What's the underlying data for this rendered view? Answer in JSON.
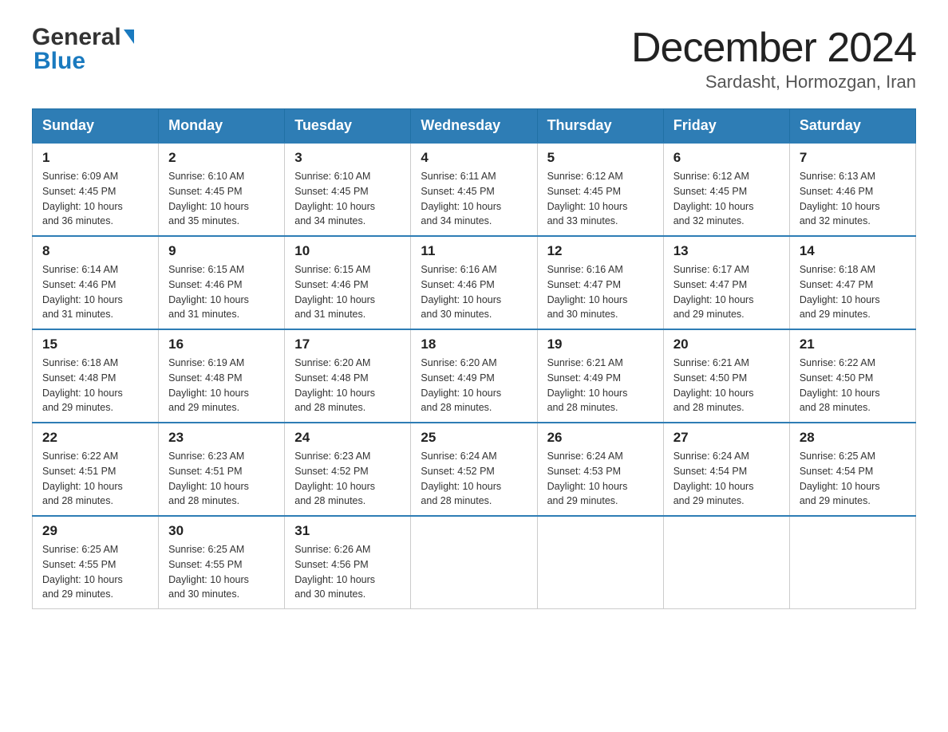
{
  "header": {
    "logo_general": "General",
    "logo_blue": "Blue",
    "month_title": "December 2024",
    "subtitle": "Sardasht, Hormozgan, Iran"
  },
  "days_of_week": [
    "Sunday",
    "Monday",
    "Tuesday",
    "Wednesday",
    "Thursday",
    "Friday",
    "Saturday"
  ],
  "weeks": [
    [
      {
        "day": "1",
        "sunrise": "6:09 AM",
        "sunset": "4:45 PM",
        "daylight": "10 hours and 36 minutes."
      },
      {
        "day": "2",
        "sunrise": "6:10 AM",
        "sunset": "4:45 PM",
        "daylight": "10 hours and 35 minutes."
      },
      {
        "day": "3",
        "sunrise": "6:10 AM",
        "sunset": "4:45 PM",
        "daylight": "10 hours and 34 minutes."
      },
      {
        "day": "4",
        "sunrise": "6:11 AM",
        "sunset": "4:45 PM",
        "daylight": "10 hours and 34 minutes."
      },
      {
        "day": "5",
        "sunrise": "6:12 AM",
        "sunset": "4:45 PM",
        "daylight": "10 hours and 33 minutes."
      },
      {
        "day": "6",
        "sunrise": "6:12 AM",
        "sunset": "4:45 PM",
        "daylight": "10 hours and 32 minutes."
      },
      {
        "day": "7",
        "sunrise": "6:13 AM",
        "sunset": "4:46 PM",
        "daylight": "10 hours and 32 minutes."
      }
    ],
    [
      {
        "day": "8",
        "sunrise": "6:14 AM",
        "sunset": "4:46 PM",
        "daylight": "10 hours and 31 minutes."
      },
      {
        "day": "9",
        "sunrise": "6:15 AM",
        "sunset": "4:46 PM",
        "daylight": "10 hours and 31 minutes."
      },
      {
        "day": "10",
        "sunrise": "6:15 AM",
        "sunset": "4:46 PM",
        "daylight": "10 hours and 31 minutes."
      },
      {
        "day": "11",
        "sunrise": "6:16 AM",
        "sunset": "4:46 PM",
        "daylight": "10 hours and 30 minutes."
      },
      {
        "day": "12",
        "sunrise": "6:16 AM",
        "sunset": "4:47 PM",
        "daylight": "10 hours and 30 minutes."
      },
      {
        "day": "13",
        "sunrise": "6:17 AM",
        "sunset": "4:47 PM",
        "daylight": "10 hours and 29 minutes."
      },
      {
        "day": "14",
        "sunrise": "6:18 AM",
        "sunset": "4:47 PM",
        "daylight": "10 hours and 29 minutes."
      }
    ],
    [
      {
        "day": "15",
        "sunrise": "6:18 AM",
        "sunset": "4:48 PM",
        "daylight": "10 hours and 29 minutes."
      },
      {
        "day": "16",
        "sunrise": "6:19 AM",
        "sunset": "4:48 PM",
        "daylight": "10 hours and 29 minutes."
      },
      {
        "day": "17",
        "sunrise": "6:20 AM",
        "sunset": "4:48 PM",
        "daylight": "10 hours and 28 minutes."
      },
      {
        "day": "18",
        "sunrise": "6:20 AM",
        "sunset": "4:49 PM",
        "daylight": "10 hours and 28 minutes."
      },
      {
        "day": "19",
        "sunrise": "6:21 AM",
        "sunset": "4:49 PM",
        "daylight": "10 hours and 28 minutes."
      },
      {
        "day": "20",
        "sunrise": "6:21 AM",
        "sunset": "4:50 PM",
        "daylight": "10 hours and 28 minutes."
      },
      {
        "day": "21",
        "sunrise": "6:22 AM",
        "sunset": "4:50 PM",
        "daylight": "10 hours and 28 minutes."
      }
    ],
    [
      {
        "day": "22",
        "sunrise": "6:22 AM",
        "sunset": "4:51 PM",
        "daylight": "10 hours and 28 minutes."
      },
      {
        "day": "23",
        "sunrise": "6:23 AM",
        "sunset": "4:51 PM",
        "daylight": "10 hours and 28 minutes."
      },
      {
        "day": "24",
        "sunrise": "6:23 AM",
        "sunset": "4:52 PM",
        "daylight": "10 hours and 28 minutes."
      },
      {
        "day": "25",
        "sunrise": "6:24 AM",
        "sunset": "4:52 PM",
        "daylight": "10 hours and 28 minutes."
      },
      {
        "day": "26",
        "sunrise": "6:24 AM",
        "sunset": "4:53 PM",
        "daylight": "10 hours and 29 minutes."
      },
      {
        "day": "27",
        "sunrise": "6:24 AM",
        "sunset": "4:54 PM",
        "daylight": "10 hours and 29 minutes."
      },
      {
        "day": "28",
        "sunrise": "6:25 AM",
        "sunset": "4:54 PM",
        "daylight": "10 hours and 29 minutes."
      }
    ],
    [
      {
        "day": "29",
        "sunrise": "6:25 AM",
        "sunset": "4:55 PM",
        "daylight": "10 hours and 29 minutes."
      },
      {
        "day": "30",
        "sunrise": "6:25 AM",
        "sunset": "4:55 PM",
        "daylight": "10 hours and 30 minutes."
      },
      {
        "day": "31",
        "sunrise": "6:26 AM",
        "sunset": "4:56 PM",
        "daylight": "10 hours and 30 minutes."
      },
      null,
      null,
      null,
      null
    ]
  ],
  "labels": {
    "sunrise": "Sunrise:",
    "sunset": "Sunset:",
    "daylight": "Daylight:"
  }
}
